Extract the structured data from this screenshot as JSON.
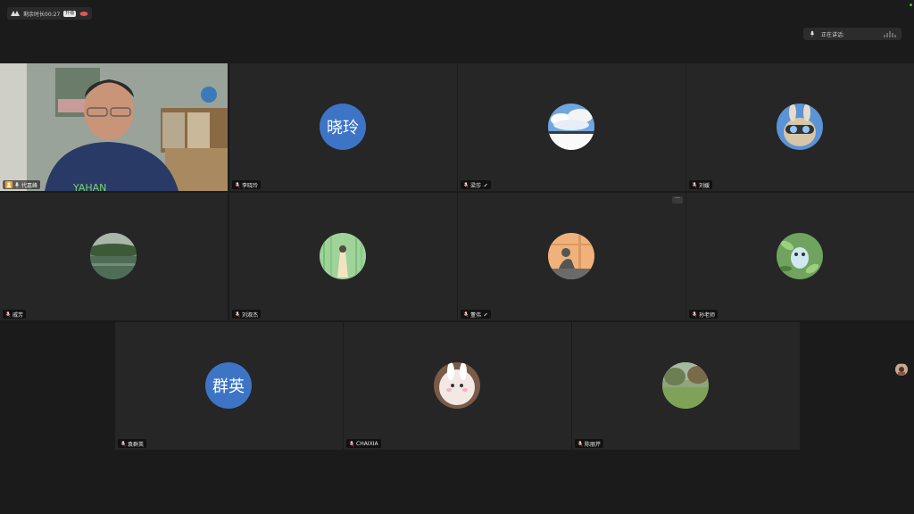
{
  "topbar": {
    "timer_text": "剩余时长00:27",
    "timer_badge": "升级",
    "speaking_label": "正在讲话:"
  },
  "participants": [
    {
      "name": "代嘉峰",
      "avatar_text": "",
      "video": true
    },
    {
      "name": "李晓玲",
      "avatar_text": "晓玲"
    },
    {
      "name": "梁莎",
      "avatar_text": ""
    },
    {
      "name": "刘媛",
      "avatar_text": ""
    },
    {
      "name": "戚芳",
      "avatar_text": ""
    },
    {
      "name": "刘淑杰",
      "avatar_text": ""
    },
    {
      "name": "董伟",
      "avatar_text": ""
    },
    {
      "name": "孙老师",
      "avatar_text": ""
    },
    {
      "name": "袁群英",
      "avatar_text": "群英"
    },
    {
      "name": "CHAIXIA",
      "avatar_text": ""
    },
    {
      "name": "陈丽芹",
      "avatar_text": ""
    }
  ],
  "tile_more_label": "···",
  "colors": {
    "background": "#1b1b1b",
    "tile": "#262626",
    "avatar_blue": "#3d74c6",
    "host_badge": "#f0a020"
  }
}
